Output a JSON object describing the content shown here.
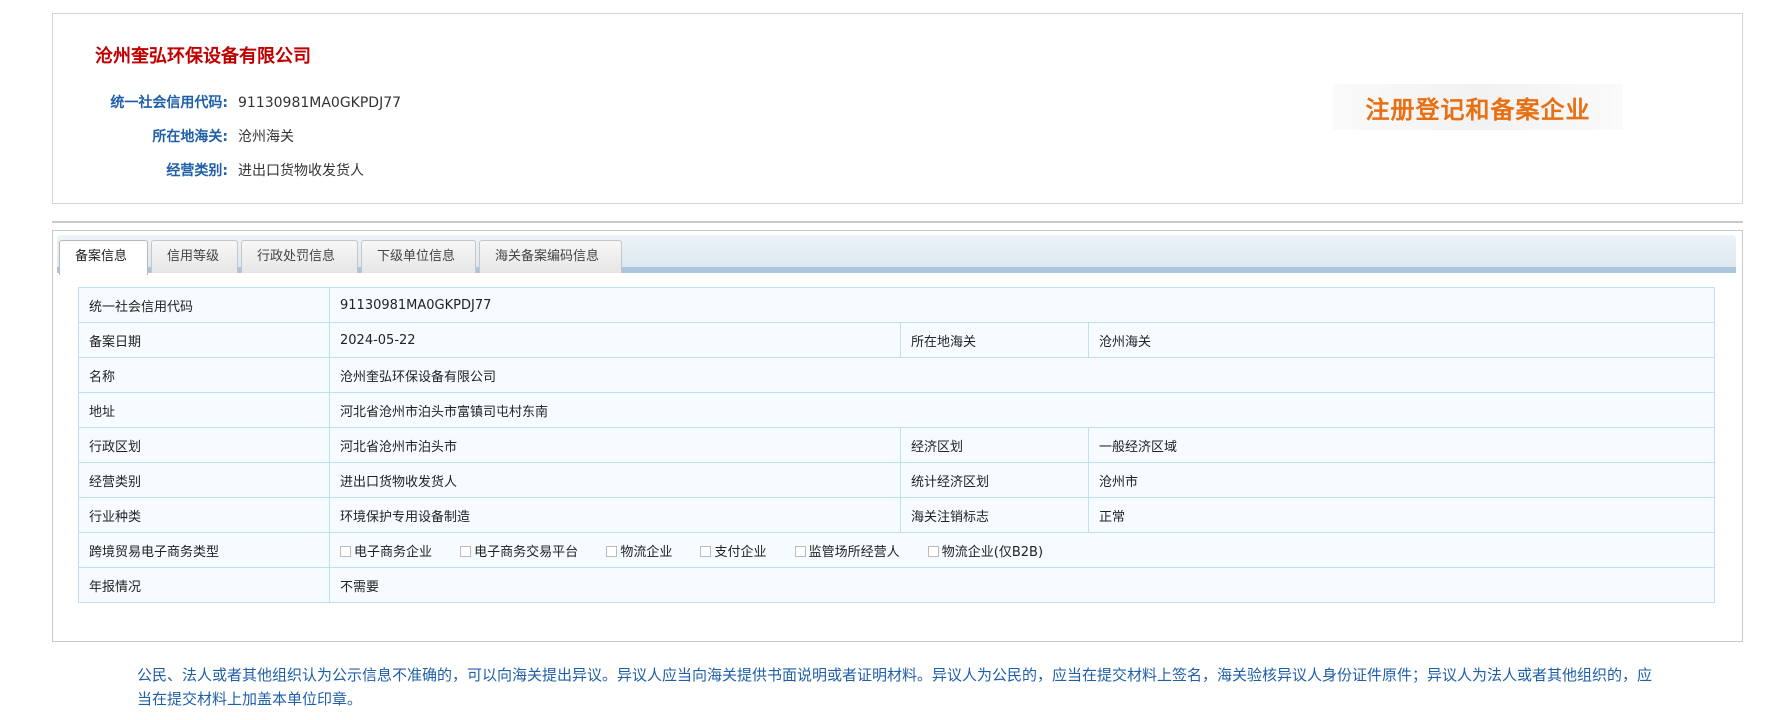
{
  "company": {
    "name": "沧州奎弘环保设备有限公司",
    "info_rows": [
      {
        "label": "统一社会信用代码:",
        "value": "91130981MA0GKPDJ77"
      },
      {
        "label": "所在地海关:",
        "value": "沧州海关"
      },
      {
        "label": "经营类别:",
        "value": "进出口货物收发货人"
      }
    ],
    "status_text": "注册登记和备案企业",
    "status_color": "#e86f12"
  },
  "tabs": [
    "备案信息",
    "信用等级",
    "行政处罚信息",
    "下级单位信息",
    "海关备案编码信息"
  ],
  "active_tab": "备案信息",
  "table": {
    "rows": [
      {
        "label": "统一社会信用代码",
        "value": "91130981MA0GKPDJ77"
      },
      {
        "label": "备案日期",
        "value": "2024-05-22",
        "label2": "所在地海关",
        "value2": "沧州海关"
      },
      {
        "label": "名称",
        "value": "沧州奎弘环保设备有限公司"
      },
      {
        "label": "地址",
        "value": "河北省沧州市泊头市富镇司屯村东南"
      },
      {
        "label": "行政区划",
        "value": "河北省沧州市泊头市",
        "label2": "经济区划",
        "value2": "一般经济区域"
      },
      {
        "label": "经营类别",
        "value": "进出口货物收发货人",
        "label2": "统计经济区划",
        "value2": "沧州市"
      },
      {
        "label": "行业种类",
        "value": "环境保护专用设备制造",
        "label2": "海关注销标志",
        "value2": "正常"
      }
    ],
    "ecommerce": {
      "label": "跨境贸易电子商务类型",
      "options": [
        {
          "label": "电子商务企业",
          "checked": false
        },
        {
          "label": "电子商务交易平台",
          "checked": false
        },
        {
          "label": "物流企业",
          "checked": false
        },
        {
          "label": "支付企业",
          "checked": false
        },
        {
          "label": "监管场所经营人",
          "checked": false
        },
        {
          "label": "物流企业(仅B2B)",
          "checked": false
        }
      ]
    },
    "annual_report": {
      "label": "年报情况",
      "value": "不需要"
    }
  },
  "notice": "公民、法人或者其他组织认为公示信息不准确的，可以向海关提出异议。异议人应当向海关提供书面说明或者证明材料。异议人为公民的，应当在提交材料上签名，海关验核异议人身份证件原件；异议人为法人或者其他组织的，应当在提交材料上加盖本单位印章。"
}
